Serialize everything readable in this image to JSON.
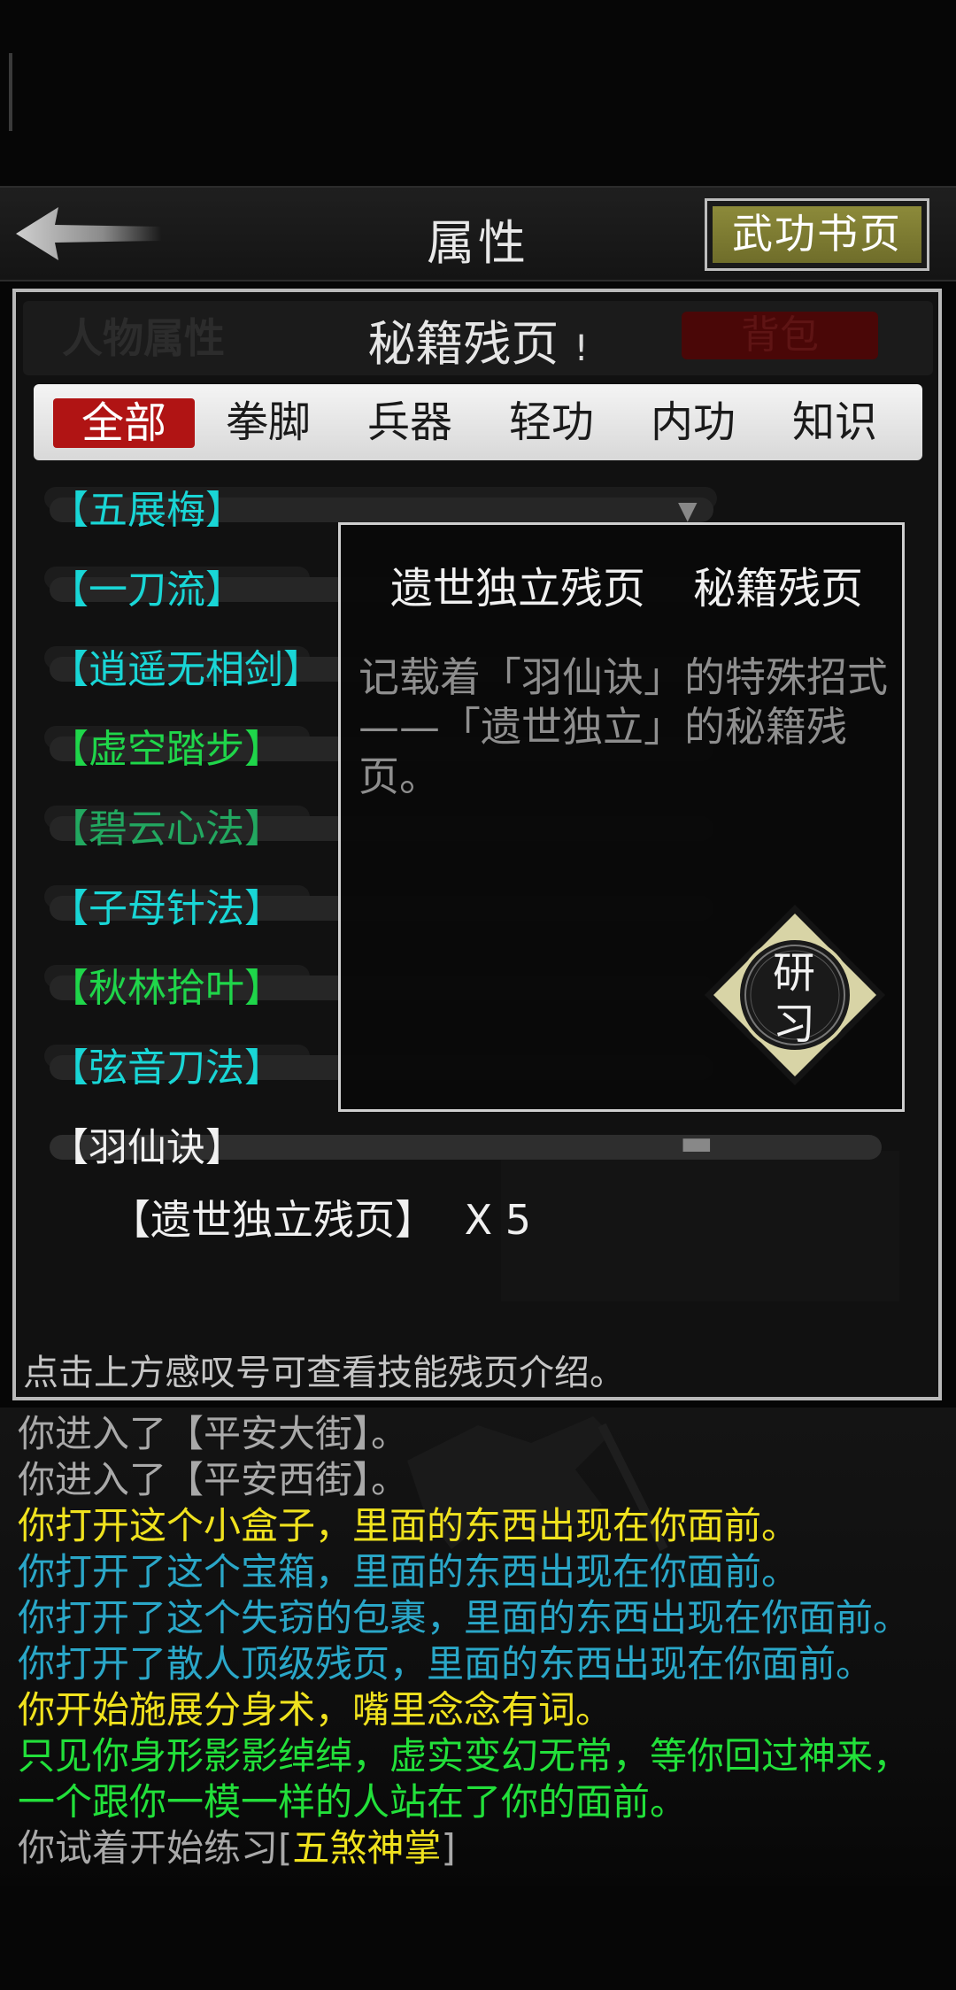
{
  "header": {
    "title": "属性",
    "manual_button": "武功书页"
  },
  "tabs": {
    "character": "人物属性",
    "fragments": "秘籍残页",
    "fragments_alert": "!",
    "bag": "背包"
  },
  "filters": [
    "全部",
    "拳脚",
    "兵器",
    "轻功",
    "内功",
    "知识"
  ],
  "active_filter": "全部",
  "skills": [
    {
      "label": "【五展梅】",
      "color": "#19d6d6"
    },
    {
      "label": "【一刀流】",
      "color": "#19d6d6"
    },
    {
      "label": "【逍遥无相剑】",
      "color": "#19d6d6"
    },
    {
      "label": "【虚空踏步】",
      "color": "#1fd64a"
    },
    {
      "label": "【碧云心法】",
      "color": "#22a860"
    },
    {
      "label": "【子母针法】",
      "color": "#19d6d6"
    },
    {
      "label": "【秋林拾叶】",
      "color": "#1fd64a"
    },
    {
      "label": "【弦音刀法】",
      "color": "#19d6d6"
    },
    {
      "label": "【羽仙诀】",
      "color": "#f2f2f2"
    }
  ],
  "expanded_item": {
    "name": "【遗世独立残页】",
    "quantity": "X 5"
  },
  "popup": {
    "title": "遗世独立残页",
    "type": "秘籍残页",
    "description": "记载着「羽仙诀」的特殊招式——「遗世独立」的秘籍残页。",
    "study_button": "研习"
  },
  "hint": "点击上方感叹号可查看技能残页介绍。",
  "log": [
    {
      "text": "你进入了【平安大街】。",
      "color": "#a9a9a9"
    },
    {
      "text": "你进入了【平安西街】。",
      "color": "#a9a9a9"
    },
    {
      "text": "你打开这个小盒子，里面的东西出现在你面前。",
      "color": "#f0e21e"
    },
    {
      "text": "你打开了这个宝箱，里面的东西出现在你面前。",
      "color": "#2aa7c8"
    },
    {
      "text": "你打开了这个失窃的包裹，里面的东西出现在你面前。",
      "color": "#2aa7c8"
    },
    {
      "text": "你打开了散人顶级残页，里面的东西出现在你面前。",
      "color": "#2aa7c8"
    },
    {
      "text": "你开始施展分身术，嘴里念念有词。",
      "color": "#f0e21e"
    },
    {
      "text": "只见你身形影影绰绰，虚实变幻无常，等你回过神来，",
      "color": "#22e03a"
    },
    {
      "text": "一个跟你一模一样的人站在了你的面前。",
      "color": "#22e03a"
    }
  ],
  "log_last": {
    "prefix": "你试着开始练习[",
    "skill": "五煞神掌",
    "suffix": "]"
  }
}
